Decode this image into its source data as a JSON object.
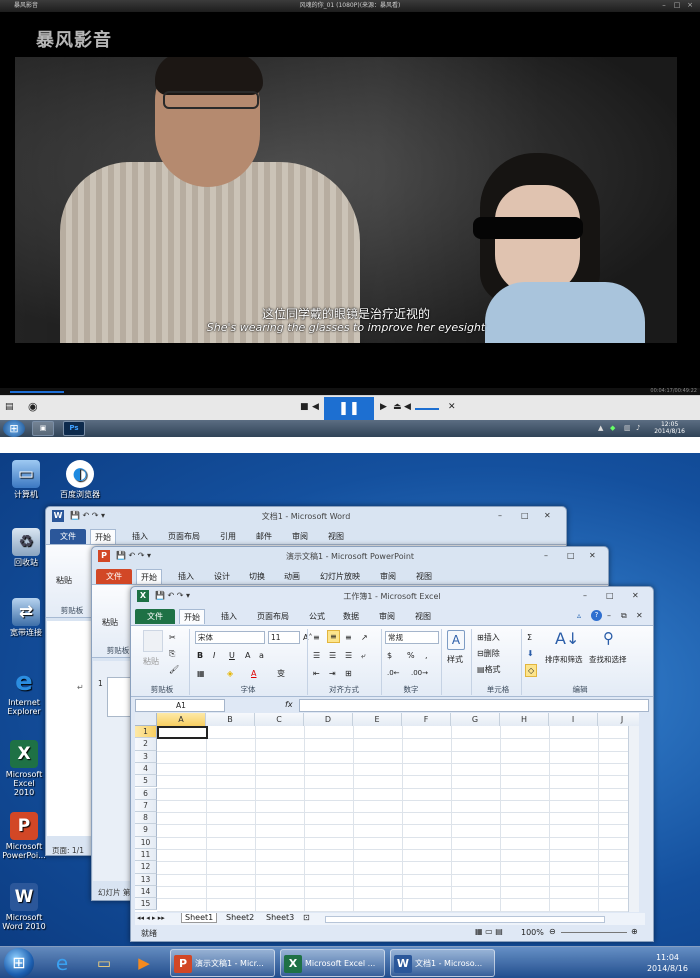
{
  "player": {
    "app_name": "暴风影音",
    "window_title": "风魂的你_01 (1080P)(来源：暴风看)",
    "logo": "暴风影音",
    "subtitle_cn": "这位同学戴的眼镜是治疗近视的",
    "subtitle_en": "She's wearing the glasses to improve her eyesight",
    "time": "00:04:17/00:49:22",
    "progress": 0.087,
    "volume": 0.6
  },
  "taskbar_top": {
    "clock_time": "12:05",
    "clock_date": "2014/8/16"
  },
  "desktop": {
    "icons": [
      {
        "label": "计算机"
      },
      {
        "label": "百度浏览器"
      },
      {
        "label": "回收站"
      },
      {
        "label": "宽带连接"
      },
      {
        "label": "Internet Explorer"
      },
      {
        "label": "Microsoft Excel 2010"
      },
      {
        "label": "Microsoft PowerPoi..."
      },
      {
        "label": "Microsoft Word 2010"
      }
    ]
  },
  "word": {
    "title": "文档1 - Microsoft Word",
    "tabs": [
      "文件",
      "开始",
      "插入",
      "页面布局",
      "引用",
      "邮件",
      "审阅",
      "视图"
    ],
    "paste": "粘贴",
    "clipboard": "剪贴板",
    "status": "页面: 1/1"
  },
  "powerpoint": {
    "title": "演示文稿1 - Microsoft PowerPoint",
    "tabs": [
      "文件",
      "开始",
      "插入",
      "设计",
      "切换",
      "动画",
      "幻灯片放映",
      "审阅",
      "视图"
    ],
    "paste": "粘贴",
    "clipboard": "剪贴板",
    "slide_num": "1",
    "status": "幻灯片 第"
  },
  "excel": {
    "title": "工作簿1 - Microsoft Excel",
    "tabs": [
      "文件",
      "开始",
      "插入",
      "页面布局",
      "公式",
      "数据",
      "审阅",
      "视图"
    ],
    "font_name": "宋体",
    "font_size": "11",
    "number_format": "常规",
    "paste": "粘贴",
    "style": "样式",
    "insert": "插入",
    "delete": "删除",
    "format": "格式",
    "sort_filter": "排序和筛选",
    "find_select": "查找和选择",
    "groups": [
      "剪贴板",
      "字体",
      "对齐方式",
      "数字",
      "单元格",
      "编辑"
    ],
    "name_box": "A1",
    "fx": "fx",
    "columns": [
      "A",
      "B",
      "C",
      "D",
      "E",
      "F",
      "G",
      "H",
      "I",
      "J"
    ],
    "rows": [
      "1",
      "2",
      "3",
      "4",
      "5",
      "6",
      "7",
      "8",
      "9",
      "10",
      "11",
      "12",
      "13",
      "14",
      "15"
    ],
    "sheets": [
      "Sheet1",
      "Sheet2",
      "Sheet3"
    ],
    "status": "就绪",
    "zoom": "100%"
  },
  "taskbar": {
    "tasks": [
      "演示文稿1 - Micr...",
      "Microsoft Excel ...",
      "文档1 - Microso..."
    ],
    "clock_time": "11:04",
    "clock_date": "2014/8/16"
  },
  "colors": {
    "word": "#2b579a",
    "powerpoint": "#d24726",
    "excel": "#1e7145",
    "player_accent": "#1d6fd1"
  }
}
